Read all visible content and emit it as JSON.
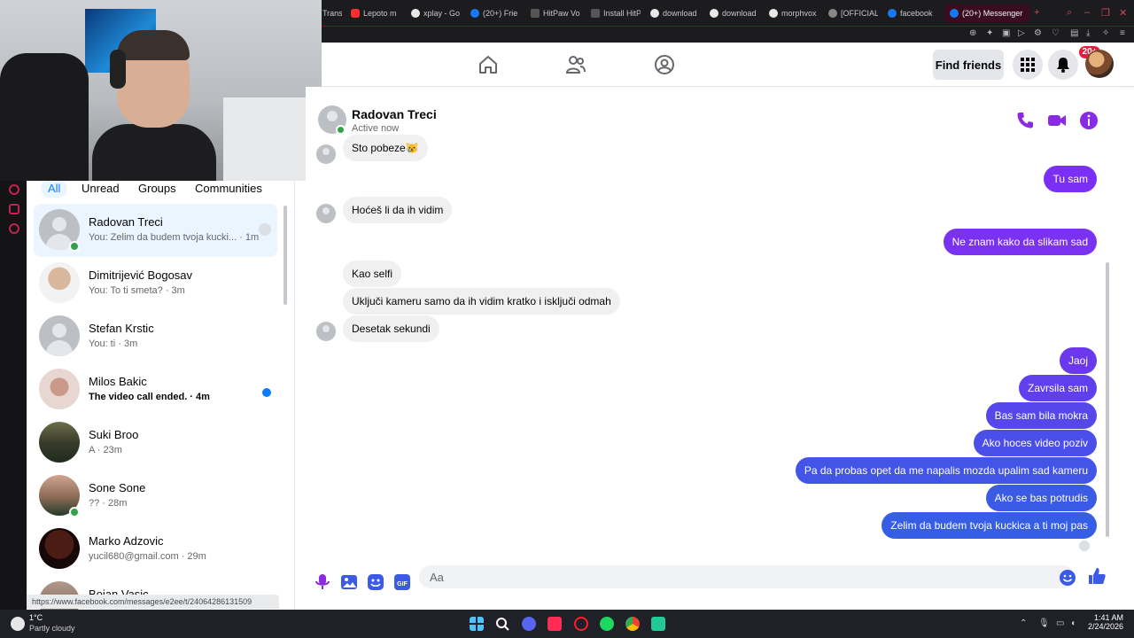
{
  "browser": {
    "tabs": [
      {
        "label": "Trans",
        "active": false
      },
      {
        "label": "Lepoto m",
        "active": false
      },
      {
        "label": "xplay - Go",
        "active": false
      },
      {
        "label": "(20+) Frie",
        "active": false
      },
      {
        "label": "HitPaw Vo",
        "active": false
      },
      {
        "label": "Install HitP",
        "active": false
      },
      {
        "label": "download",
        "active": false
      },
      {
        "label": "download",
        "active": false
      },
      {
        "label": "morphvox",
        "active": false
      },
      {
        "label": "[OFFICIAL",
        "active": false
      },
      {
        "label": "facebook",
        "active": false
      },
      {
        "label": "(20+) Messenger",
        "active": true
      }
    ],
    "status_url": "https://www.facebook.com/messages/e2ee/t/24064286131509"
  },
  "fbnav": {
    "find_friends": "Find friends",
    "notification_count": "20+"
  },
  "sidebar": {
    "filters": [
      "All",
      "Unread",
      "Groups",
      "Communities"
    ],
    "chats": [
      {
        "name": "Radovan Treci",
        "preview": "You: Zelim da budem tvoja kucki... · 1m",
        "online": true,
        "selected": true,
        "unread": false,
        "avatar": "default"
      },
      {
        "name": "Dimitrijević Bogosav",
        "preview": "You: To ti smeta? · 3m",
        "online": false,
        "selected": false,
        "unread": false,
        "avatar": "photo"
      },
      {
        "name": "Stefan Krstic",
        "preview": "You: ti · 3m",
        "online": false,
        "selected": false,
        "unread": false,
        "avatar": "default"
      },
      {
        "name": "Milos Bakic",
        "preview": "The video call ended. · 4m",
        "online": false,
        "selected": false,
        "unread": true,
        "avatar": "photo"
      },
      {
        "name": "Suki Broo",
        "preview": "A · 23m",
        "online": false,
        "selected": false,
        "unread": false,
        "avatar": "photo"
      },
      {
        "name": "Sone Sone",
        "preview": "?? · 28m",
        "online": true,
        "selected": false,
        "unread": false,
        "avatar": "photo"
      },
      {
        "name": "Marko Adzovic",
        "preview": "yucil680@gmail.com · 29m",
        "online": false,
        "selected": false,
        "unread": false,
        "avatar": "photo"
      },
      {
        "name": "Bojan Vasic",
        "preview": "",
        "online": false,
        "selected": false,
        "unread": false,
        "avatar": "photo"
      }
    ]
  },
  "conversation": {
    "contact_name": "Radovan Treci",
    "status": "Active now",
    "messages": [
      {
        "from": "them",
        "text": "Sto pobeze😿"
      },
      {
        "from": "me",
        "text": "Tu sam"
      },
      {
        "from": "them",
        "text": "Hoćeš li da ih vidim"
      },
      {
        "from": "me",
        "text": "Ne znam kako da slikam sad"
      },
      {
        "from": "them",
        "text": "Kao selfi"
      },
      {
        "from": "them",
        "text": "Uključi kameru samo da ih vidim kratko i isključi odmah"
      },
      {
        "from": "them",
        "text": "Desetak sekundi"
      },
      {
        "from": "me",
        "text": "Jaoj"
      },
      {
        "from": "me",
        "text": "Zavrsila sam"
      },
      {
        "from": "me",
        "text": "Bas sam bila mokra"
      },
      {
        "from": "me",
        "text": "Ako hoces video poziv"
      },
      {
        "from": "me",
        "text": "Pa da probas opet da me napalis mozda upalim sad kameru"
      },
      {
        "from": "me",
        "text": "Ako se bas potrudis"
      },
      {
        "from": "me",
        "text": "Zelim da budem tvoja kuckica a ti moj pas"
      }
    ],
    "composer_placeholder": "Aa"
  },
  "taskbar": {
    "temperature": "1°C",
    "weather": "Partly cloudy",
    "time": "1:41 AM",
    "date": "2/24/2026"
  },
  "colors": {
    "accent": "#0a7cff",
    "messenger_purple": "#8a2be2",
    "online": "#31a24c",
    "badge": "#e41e3f"
  }
}
